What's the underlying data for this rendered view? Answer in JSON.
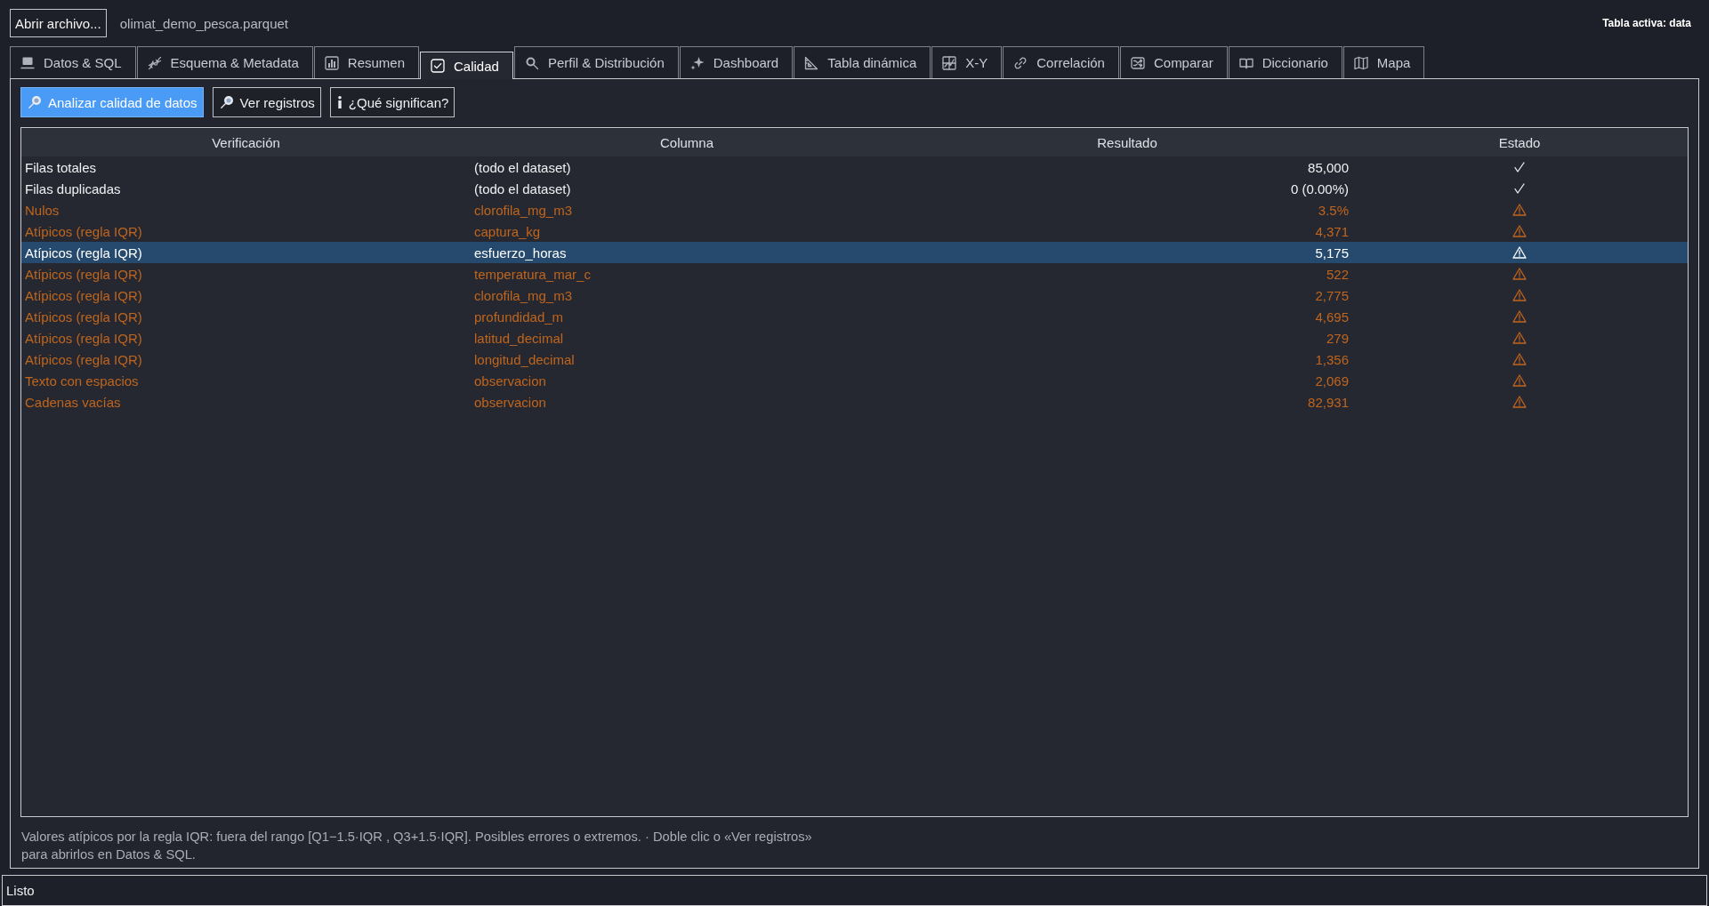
{
  "toolbar": {
    "open_button": "Abrir archivo...",
    "file_name": "olimat_demo_pesca.parquet",
    "active_table": "Tabla activa: data"
  },
  "tabs": [
    {
      "label": "Datos & SQL",
      "selected": false
    },
    {
      "label": "Esquema & Metadata",
      "selected": false
    },
    {
      "label": "Resumen",
      "selected": false
    },
    {
      "label": "Calidad",
      "selected": true
    },
    {
      "label": "Perfil & Distribución",
      "selected": false
    },
    {
      "label": "Dashboard",
      "selected": false
    },
    {
      "label": "Tabla dinámica",
      "selected": false
    },
    {
      "label": "X-Y",
      "selected": false
    },
    {
      "label": "Correlación",
      "selected": false
    },
    {
      "label": "Comparar",
      "selected": false
    },
    {
      "label": "Diccionario",
      "selected": false
    },
    {
      "label": "Mapa",
      "selected": false
    }
  ],
  "actions": [
    {
      "label": "Analizar calidad de datos",
      "primary": true
    },
    {
      "label": "Ver registros",
      "primary": false
    },
    {
      "label": "¿Qué significan?",
      "primary": false
    }
  ],
  "table": {
    "columns": [
      "Verificación",
      "Columna",
      "Resultado",
      "Estado"
    ],
    "rows": [
      {
        "check": "Filas totales",
        "column": "(todo el dataset)",
        "result": "85,000",
        "warning": false,
        "selected": false
      },
      {
        "check": "Filas duplicadas",
        "column": "(todo el dataset)",
        "result": "0 (0.00%)",
        "warning": false,
        "selected": false
      },
      {
        "check": "Nulos",
        "column": "clorofila_mg_m3",
        "result": "3.5%",
        "warning": true,
        "selected": false
      },
      {
        "check": "Atípicos (regla IQR)",
        "column": "captura_kg",
        "result": "4,371",
        "warning": true,
        "selected": false
      },
      {
        "check": "Atípicos (regla IQR)",
        "column": "esfuerzo_horas",
        "result": "5,175",
        "warning": true,
        "selected": true
      },
      {
        "check": "Atípicos (regla IQR)",
        "column": "temperatura_mar_c",
        "result": "522",
        "warning": true,
        "selected": false
      },
      {
        "check": "Atípicos (regla IQR)",
        "column": "clorofila_mg_m3",
        "result": "2,775",
        "warning": true,
        "selected": false
      },
      {
        "check": "Atípicos (regla IQR)",
        "column": "profundidad_m",
        "result": "4,695",
        "warning": true,
        "selected": false
      },
      {
        "check": "Atípicos (regla IQR)",
        "column": "latitud_decimal",
        "result": "279",
        "warning": true,
        "selected": false
      },
      {
        "check": "Atípicos (regla IQR)",
        "column": "longitud_decimal",
        "result": "1,356",
        "warning": true,
        "selected": false
      },
      {
        "check": "Texto con espacios",
        "column": "observacion",
        "result": "2,069",
        "warning": true,
        "selected": false
      },
      {
        "check": "Cadenas vacías",
        "column": "observacion",
        "result": "82,931",
        "warning": true,
        "selected": false
      }
    ]
  },
  "note": "Valores atípicos por la regla IQR: fuera del rango [Q1−1.5·IQR , Q3+1.5·IQR]. Posibles errores o extremos. · Doble clic o «Ver registros» para abrirlos en Datos & SQL.",
  "status_bar": "Listo"
}
